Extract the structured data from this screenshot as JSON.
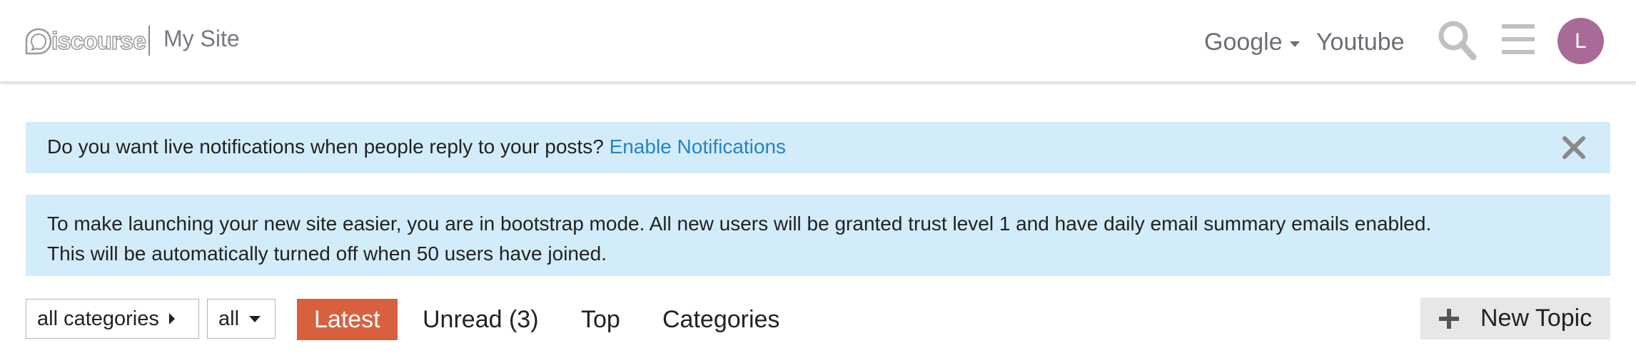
{
  "header": {
    "logo_text": "iscourse",
    "site_title": "My Site",
    "nav": [
      {
        "label": "Google",
        "has_dropdown": true
      },
      {
        "label": "Youtube",
        "has_dropdown": false
      }
    ],
    "icons": [
      "search-icon",
      "hamburger-menu-icon"
    ],
    "avatar_letter": "L",
    "avatar_color": "#a96a97"
  },
  "banners": {
    "notifications": {
      "text": "Do you want live notifications when people reply to your posts?",
      "link": "Enable Notifications",
      "close_icon": "close-icon"
    },
    "bootstrap": {
      "line1": "To make launching your new site easier, you are in bootstrap mode. All new users will be granted trust level 1 and have daily email summary emails enabled.",
      "line2": "This will be automatically turned off when 50 users have joined."
    }
  },
  "navigation": {
    "category_filter": "all categories",
    "tag_filter": "all",
    "tabs": [
      {
        "label": "Latest",
        "active": true
      },
      {
        "label": "Unread (3)",
        "active": false
      },
      {
        "label": "Top",
        "active": false
      },
      {
        "label": "Categories",
        "active": false
      }
    ],
    "new_topic_label": "New Topic"
  },
  "colors": {
    "accent": "#d9603f",
    "banner_bg": "#d3ecfa",
    "link": "#2882c8"
  }
}
